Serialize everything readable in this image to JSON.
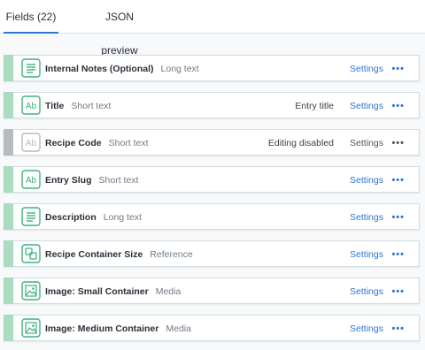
{
  "tabs": [
    {
      "label": "Fields (22)",
      "active": true
    },
    {
      "label": "JSON preview",
      "active": false
    }
  ],
  "colors": {
    "accent": "#2e75d4",
    "field_bar": "#a9dcc0",
    "field_bar_disabled": "#b7bbbf",
    "icon": "#3fb27f",
    "icon_disabled": "#b7bbbf"
  },
  "fields": [
    {
      "name": "Internal Notes (Optional)",
      "type": "Long text",
      "note": "",
      "settings": "Settings",
      "more": "•••",
      "icon": "long-text-icon",
      "disabled": false
    },
    {
      "name": "Title",
      "type": "Short text",
      "note": "Entry title",
      "settings": "Settings",
      "more": "•••",
      "icon": "short-text-icon",
      "disabled": false
    },
    {
      "name": "Recipe Code",
      "type": "Short text",
      "note": "Editing disabled",
      "settings": "Settings",
      "more": "•••",
      "icon": "short-text-icon",
      "disabled": true
    },
    {
      "name": "Entry Slug",
      "type": "Short text",
      "note": "",
      "settings": "Settings",
      "more": "•••",
      "icon": "short-text-icon",
      "disabled": false
    },
    {
      "name": "Description",
      "type": "Long text",
      "note": "",
      "settings": "Settings",
      "more": "•••",
      "icon": "long-text-icon",
      "disabled": false
    },
    {
      "name": "Recipe Container Size",
      "type": "Reference",
      "note": "",
      "settings": "Settings",
      "more": "•••",
      "icon": "reference-icon",
      "disabled": false
    },
    {
      "name": "Image: Small Container",
      "type": "Media",
      "note": "",
      "settings": "Settings",
      "more": "•••",
      "icon": "media-icon",
      "disabled": false
    },
    {
      "name": "Image: Medium Container",
      "type": "Media",
      "note": "",
      "settings": "Settings",
      "more": "•••",
      "icon": "media-icon",
      "disabled": false
    }
  ]
}
